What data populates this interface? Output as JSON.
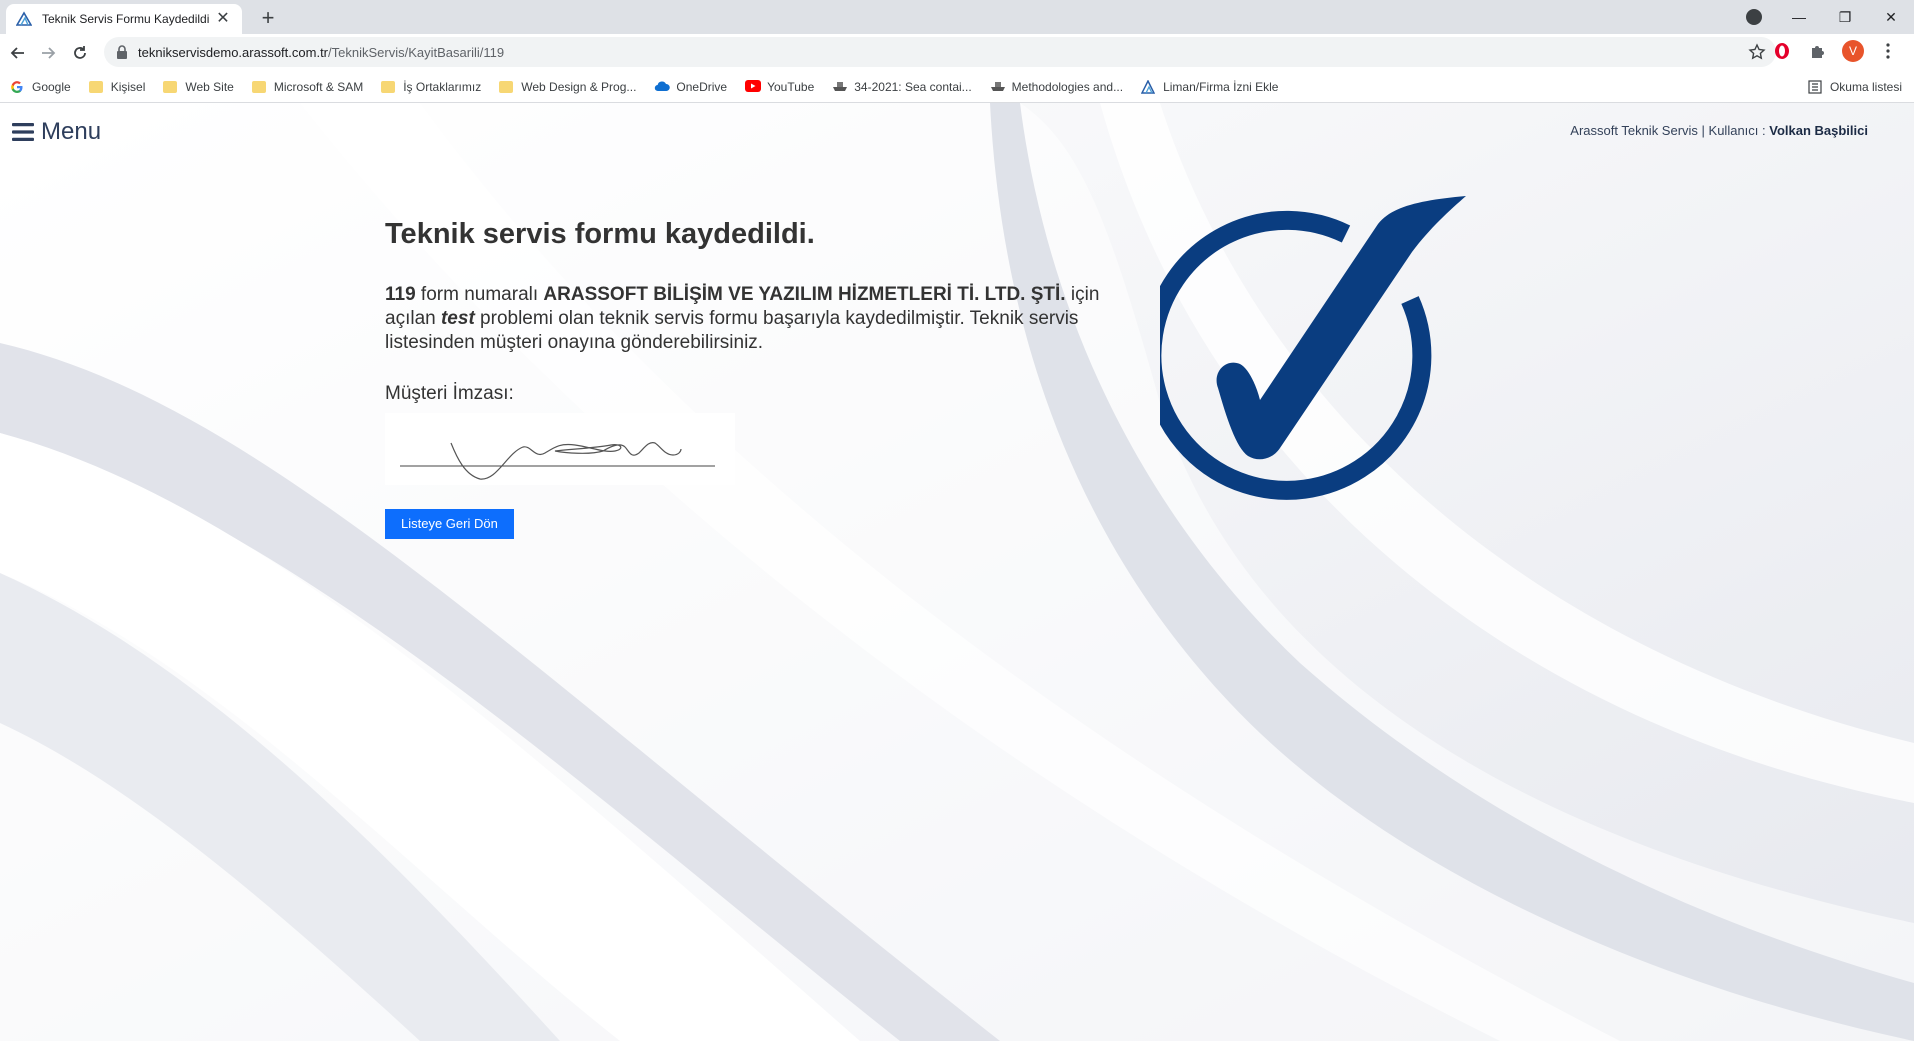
{
  "browser": {
    "tab_title": "Teknik Servis Formu Kaydedildi",
    "url_host": "teknikservisdemo.arassoft.com.tr",
    "url_path": "/TeknikServis/KayitBasarili/119",
    "avatar_letter": "V",
    "bookmarks": [
      {
        "label": "Google",
        "icon": "google-icon"
      },
      {
        "label": "Kişisel",
        "icon": "folder-icon"
      },
      {
        "label": "Web Site",
        "icon": "folder-icon"
      },
      {
        "label": "Microsoft & SAM",
        "icon": "folder-icon"
      },
      {
        "label": "İş Ortaklarımız",
        "icon": "folder-icon"
      },
      {
        "label": "Web Design & Prog...",
        "icon": "folder-icon"
      },
      {
        "label": "OneDrive",
        "icon": "onedrive-icon"
      },
      {
        "label": "YouTube",
        "icon": "youtube-icon"
      },
      {
        "label": "34-2021: Sea contai...",
        "icon": "ship-icon"
      },
      {
        "label": "Methodologies and...",
        "icon": "ship-icon"
      },
      {
        "label": "Liman/Firma İzni Ekle",
        "icon": "arassoft-icon"
      }
    ],
    "reading_list": "Okuma listesi"
  },
  "header": {
    "menu_label": "Menu",
    "company": "Arassoft Teknik Servis",
    "user_label": "Kullanıcı :",
    "user_name": "Volkan Başbilici"
  },
  "main": {
    "title": "Teknik servis formu kaydedildi.",
    "form_number": "119",
    "text_1": " form numaralı ",
    "company_name": "ARASSOFT BİLİŞİM VE YAZILIM HİZMETLERİ Tİ. LTD. ŞTİ.",
    "text_2": " için açılan ",
    "problem": "test",
    "text_3": " problemi olan teknik servis formu başarıyla kaydedilmiştir. Teknik servis listesinden müşteri onayına gönderebilirsiniz.",
    "signature_label": "Müşteri İmzası:",
    "back_button": "Listeye Geri Dön"
  },
  "colors": {
    "accent_blue": "#0d6efd",
    "check_navy": "#0a3d80"
  }
}
